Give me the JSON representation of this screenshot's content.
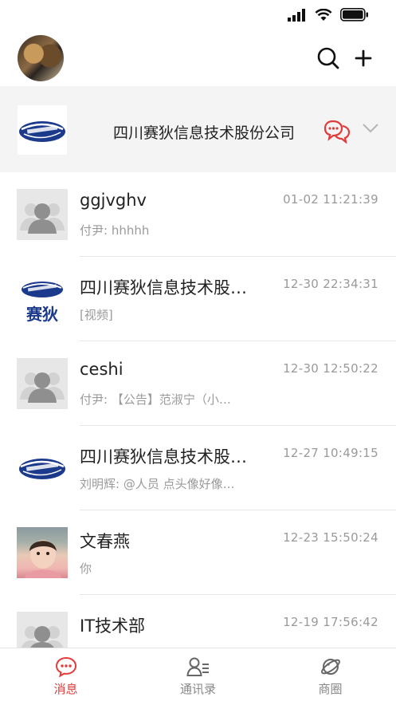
{
  "status_bar": {
    "signal_icon": "cellular-signal-icon",
    "wifi_icon": "wifi-icon",
    "battery_icon": "battery-icon"
  },
  "header": {
    "avatar_icon": "user-avatar",
    "search_icon": "search-icon",
    "add_icon": "plus-icon"
  },
  "org_banner": {
    "name": "四川赛狄信息技术股份公司",
    "logo_icon": "company-logo",
    "chat_icon": "chat-bubbles-icon",
    "expand_icon": "chevron-down-icon"
  },
  "colors": {
    "accent": "#e23b3b",
    "logo_blue": "#1c3a8c",
    "gray_text": "#9a9a9a"
  },
  "conversations": [
    {
      "title": "ggjvghv",
      "time": "01-02 11:21:39",
      "preview": "付尹: hhhhh",
      "avatar": "default-person-avatar"
    },
    {
      "title": "四川赛狄信息技术股…",
      "time": "12-30 22:34:31",
      "preview": "[视频]",
      "avatar": "company-logo-with-text",
      "logo_text": "赛狄"
    },
    {
      "title": "ceshi",
      "time": "12-30 12:50:22",
      "preview": "付尹: 【公告】范淑宁（小…",
      "avatar": "default-person-avatar"
    },
    {
      "title": "四川赛狄信息技术股…",
      "time": "12-27 10:49:15",
      "preview": "刘明辉: @人员 点头像好像…",
      "avatar": "company-logo"
    },
    {
      "title": "文春燕",
      "time": "12-23 15:50:24",
      "preview": "你",
      "avatar": "child-photo-avatar"
    },
    {
      "title": "IT技术部",
      "time": "12-19 17:56:42",
      "preview": "",
      "avatar": "default-person-avatar"
    }
  ],
  "tabs": [
    {
      "label": "消息",
      "icon": "message-icon",
      "active": true
    },
    {
      "label": "通讯录",
      "icon": "contacts-icon",
      "active": false
    },
    {
      "label": "商圈",
      "icon": "planet-icon",
      "active": false
    }
  ]
}
